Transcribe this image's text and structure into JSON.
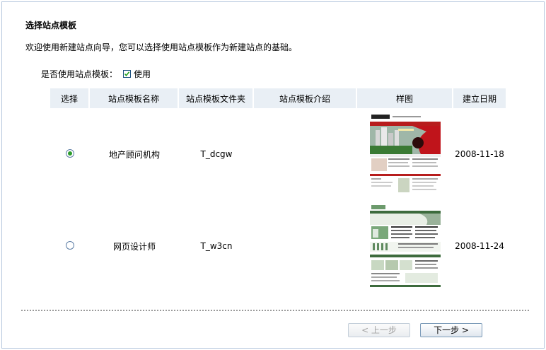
{
  "page": {
    "title": "选择站点模板",
    "description": "欢迎使用新建站点向导，您可以选择使用站点模板作为新建站点的基础。"
  },
  "use_template": {
    "label": "是否使用站点模板：",
    "checkbox_label": "使用",
    "checked": true
  },
  "table": {
    "headers": [
      "选择",
      "站点模板名称",
      "站点模板文件夹",
      "站点模板介绍",
      "样图",
      "建立日期"
    ],
    "rows": [
      {
        "selected": true,
        "name": "地产顾问机构",
        "folder": "T_dcgw",
        "intro": "",
        "date": "2008-11-18"
      },
      {
        "selected": false,
        "name": "网页设计师",
        "folder": "T_w3cn",
        "intro": "",
        "date": "2008-11-24"
      }
    ]
  },
  "buttons": {
    "prev": "< 上一步",
    "next": "下一步 >"
  },
  "colors": {
    "header_bg": "#e9eff5",
    "frame_border": "#b5c7dd",
    "radio_selected": "#2b9b2b"
  }
}
